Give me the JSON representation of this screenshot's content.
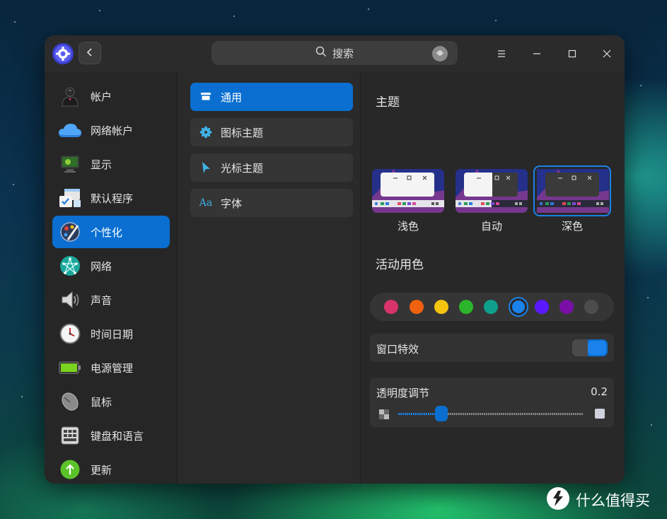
{
  "search": {
    "placeholder": "搜索"
  },
  "sidebar": {
    "items": [
      {
        "label": "帐户",
        "icon": "user-avatar-icon"
      },
      {
        "label": "网络帐户",
        "icon": "cloud-icon"
      },
      {
        "label": "显示",
        "icon": "monitor-icon"
      },
      {
        "label": "默认程序",
        "icon": "default-apps-icon"
      },
      {
        "label": "个性化",
        "icon": "palette-icon",
        "active": true
      },
      {
        "label": "网络",
        "icon": "network-icon"
      },
      {
        "label": "声音",
        "icon": "speaker-icon"
      },
      {
        "label": "时间日期",
        "icon": "clock-icon"
      },
      {
        "label": "电源管理",
        "icon": "battery-icon"
      },
      {
        "label": "鼠标",
        "icon": "mouse-icon"
      },
      {
        "label": "键盘和语言",
        "icon": "keyboard-icon"
      },
      {
        "label": "更新",
        "icon": "update-icon"
      }
    ]
  },
  "subnav": {
    "items": [
      {
        "label": "通用",
        "icon": "window-icon",
        "active": true
      },
      {
        "label": "图标主题",
        "icon": "flower-icon"
      },
      {
        "label": "光标主题",
        "icon": "cursor-icon"
      },
      {
        "label": "字体",
        "icon": "font-icon",
        "glyph": "Aa"
      }
    ]
  },
  "content": {
    "theme_title": "主题",
    "themes": [
      {
        "label": "浅色"
      },
      {
        "label": "自动"
      },
      {
        "label": "深色",
        "selected": true
      }
    ],
    "accent_title": "活动用色",
    "accent_colors": [
      "#d8336a",
      "#f0620f",
      "#f6c30f",
      "#2bb52b",
      "#0fa08d",
      "#1a82ea",
      "#5a1aff",
      "#7a0fa8",
      "#4d4d4d"
    ],
    "selected_accent": "#1a82ea",
    "window_effect": {
      "label": "窗口特效",
      "enabled": true
    },
    "transparency": {
      "label": "透明度调节",
      "value_text": "0.2",
      "value": 0.2
    }
  },
  "watermark": {
    "text": "什么值得买"
  },
  "colors": {
    "accent": "#0a6fd0"
  }
}
